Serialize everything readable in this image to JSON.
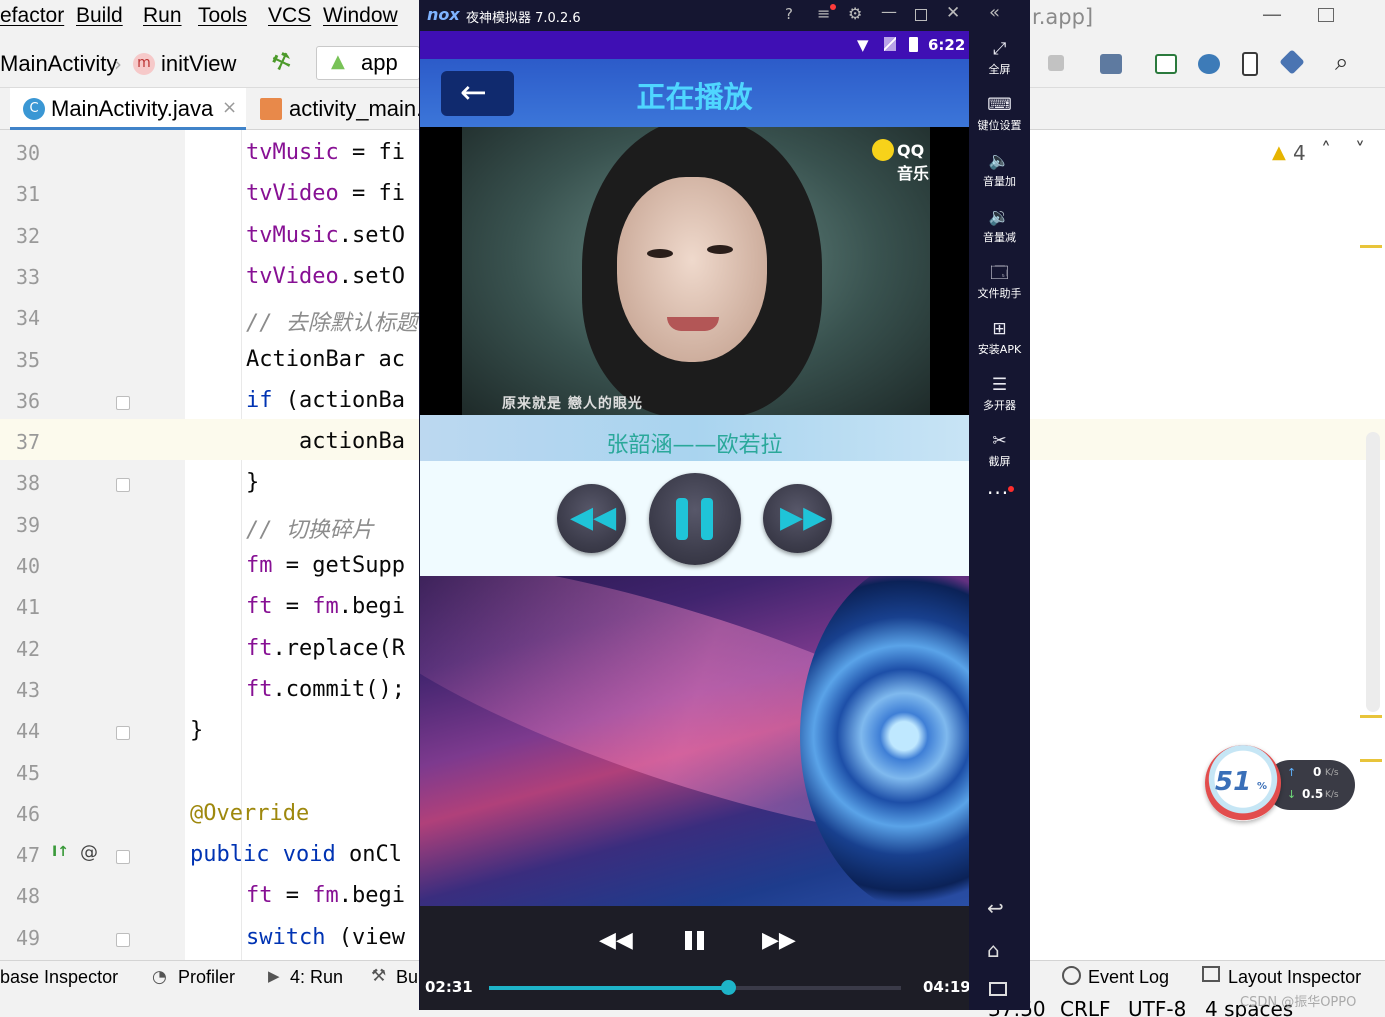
{
  "ide": {
    "menu": [
      "efactor",
      "Build",
      "Run",
      "Tools",
      "VCS",
      "Window"
    ],
    "window_title_fragment": "r.app]",
    "breadcrumb": {
      "class": "MainActivity",
      "method_badge": "m",
      "method": "initView"
    },
    "run_config": "app",
    "tabs": [
      {
        "icon": "C",
        "label": "MainActivity.java",
        "close": "×"
      },
      {
        "label": "activity_main."
      }
    ],
    "inspections": {
      "warnings": "4"
    },
    "lines": [
      {
        "n": "30",
        "code": [
          [
            "fld",
            "tvMusic"
          ],
          [
            "pl",
            " = fi"
          ]
        ]
      },
      {
        "n": "31",
        "code": [
          [
            "fld",
            "tvVideo"
          ],
          [
            "pl",
            " = fi"
          ]
        ]
      },
      {
        "n": "32",
        "code": [
          [
            "fld",
            "tvMusic"
          ],
          [
            "pl",
            ".setO"
          ]
        ]
      },
      {
        "n": "33",
        "code": [
          [
            "fld",
            "tvVideo"
          ],
          [
            "pl",
            ".setO"
          ]
        ]
      },
      {
        "n": "34",
        "code": [
          [
            "cm",
            "// 去除默认标题"
          ]
        ]
      },
      {
        "n": "35",
        "code": [
          [
            "pl",
            "ActionBar ac"
          ]
        ]
      },
      {
        "n": "36",
        "code": [
          [
            "kw",
            "if"
          ],
          [
            "pl",
            " (actionBa"
          ]
        ]
      },
      {
        "n": "37",
        "code": [
          [
            "pl",
            "    actionBa"
          ]
        ]
      },
      {
        "n": "38",
        "code": [
          [
            "pl",
            "}"
          ]
        ]
      },
      {
        "n": "39",
        "code": [
          [
            "cm",
            "// 切换碎片"
          ]
        ]
      },
      {
        "n": "40",
        "code": [
          [
            "fld",
            "fm"
          ],
          [
            "pl",
            " = getSupp"
          ]
        ]
      },
      {
        "n": "41",
        "code": [
          [
            "fld",
            "ft"
          ],
          [
            "pl",
            " = "
          ],
          [
            "fld",
            "fm"
          ],
          [
            "pl",
            ".begi"
          ]
        ]
      },
      {
        "n": "42",
        "code": [
          [
            "fld",
            "ft"
          ],
          [
            "pl",
            ".replace(R"
          ]
        ]
      },
      {
        "n": "43",
        "code": [
          [
            "fld",
            "ft"
          ],
          [
            "pl",
            ".commit();"
          ]
        ]
      },
      {
        "n": "44",
        "code": [
          [
            "pl",
            "}"
          ]
        ]
      },
      {
        "n": "45",
        "code": []
      },
      {
        "n": "46",
        "code": [
          [
            "an",
            "@Override"
          ]
        ]
      },
      {
        "n": "47",
        "code": [
          [
            "kw",
            "public void "
          ],
          [
            "pl",
            "onCl"
          ]
        ]
      },
      {
        "n": "48",
        "code": [
          [
            "fld",
            "ft"
          ],
          [
            "pl",
            " = "
          ],
          [
            "fld",
            "fm"
          ],
          [
            "pl",
            ".begi"
          ]
        ]
      },
      {
        "n": "49",
        "code": [
          [
            "kw",
            "switch"
          ],
          [
            "pl",
            " (view"
          ]
        ]
      }
    ],
    "gutter_at": "@",
    "bottom_tools": [
      {
        "label": "base Inspector"
      },
      {
        "label": "Profiler"
      },
      {
        "label": "4: Run"
      },
      {
        "label": "Bu"
      },
      {
        "label": "Event Log"
      },
      {
        "label": "Layout Inspector"
      }
    ],
    "status": {
      "position": "37:50",
      "line_sep": "CRLF",
      "encoding": "UTF-8",
      "indent": "4 spaces"
    },
    "watermark": "CSDN @振华OPPO"
  },
  "emulator": {
    "title": "夜神模拟器 7.0.2.6",
    "logo": "nox",
    "side_items": [
      {
        "label": "全屏",
        "icon": "fullscreen-icon",
        "glyph": "⤢"
      },
      {
        "label": "键位设置",
        "icon": "keyboard-icon",
        "glyph": "⌨"
      },
      {
        "label": "音量加",
        "icon": "volume-up-icon",
        "glyph": "🔈"
      },
      {
        "label": "音量减",
        "icon": "volume-down-icon",
        "glyph": "🔉"
      },
      {
        "label": "文件助手",
        "icon": "file-icon",
        "glyph": "🗔"
      },
      {
        "label": "安装APK",
        "icon": "apk-icon",
        "glyph": "⊞"
      },
      {
        "label": "多开器",
        "icon": "multi-icon",
        "glyph": "☰"
      },
      {
        "label": "截屏",
        "icon": "scissors-icon",
        "glyph": "✂"
      }
    ],
    "more": "···"
  },
  "phone": {
    "status_time": "6:22",
    "page_title": "正在播放",
    "video_watermark": "QQ音乐",
    "video_subtitle": "原来就是 戀人的眼光",
    "song_title": "张韶涵——欧若拉",
    "player": {
      "current": "02:31",
      "total": "04:19",
      "progress": 0.58
    }
  },
  "tray": {
    "percent": "51",
    "up": "0",
    "down": "0.5",
    "unit": "K/s"
  },
  "colors": {
    "accent": "#1eb4c8",
    "appbar": "#2c5bc9",
    "statusbar": "#3f0fb4",
    "title_cyan": "#4fd6ff"
  }
}
